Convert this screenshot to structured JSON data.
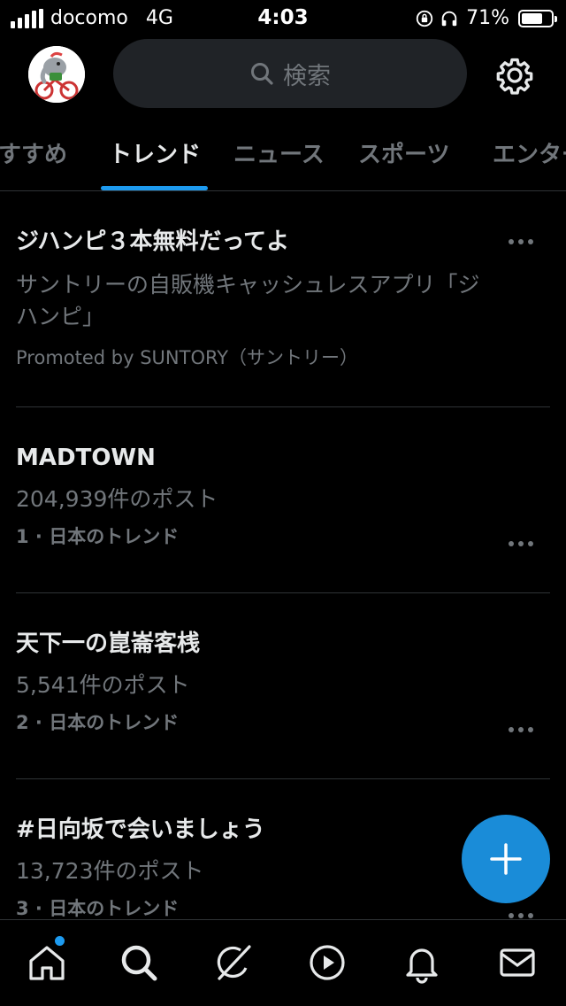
{
  "status_bar": {
    "carrier": "docomo",
    "network": "4G",
    "time": "4:03",
    "battery": "71%"
  },
  "search": {
    "placeholder": "検索"
  },
  "tabs": [
    {
      "label": "おすすめ",
      "active": false
    },
    {
      "label": "トレンド",
      "active": true
    },
    {
      "label": "ニュース",
      "active": false
    },
    {
      "label": "スポーツ",
      "active": false
    },
    {
      "label": "エンター",
      "active": false
    }
  ],
  "trends": [
    {
      "title": "ジハンピ３本無料だってよ",
      "description_line1": "サントリーの自販機キャッシュレスアプリ「ジ",
      "description_line2": "ハンピ」",
      "promoted": "Promoted by SUNTORY（サントリー）"
    },
    {
      "title": "MADTOWN",
      "posts": "204,939件のポスト",
      "rank": "1 · 日本のトレンド"
    },
    {
      "title": "天下一の崑崙客桟",
      "posts": "5,541件のポスト",
      "rank": "2 · 日本のトレンド"
    },
    {
      "title": "#日向坂で会いましょう",
      "posts": "13,723件のポスト",
      "rank": "3 · 日本のトレンド"
    }
  ],
  "colors": {
    "background": "#000000",
    "accent": "#1d9bf0",
    "fab": "#1a8cd8",
    "secondary_text": "#71767b"
  },
  "icons": {
    "settings": "gear-icon",
    "fab": "plus-icon",
    "nav": [
      "home-icon",
      "search-icon",
      "grok-icon",
      "video-icon",
      "notifications-icon",
      "messages-icon"
    ]
  }
}
